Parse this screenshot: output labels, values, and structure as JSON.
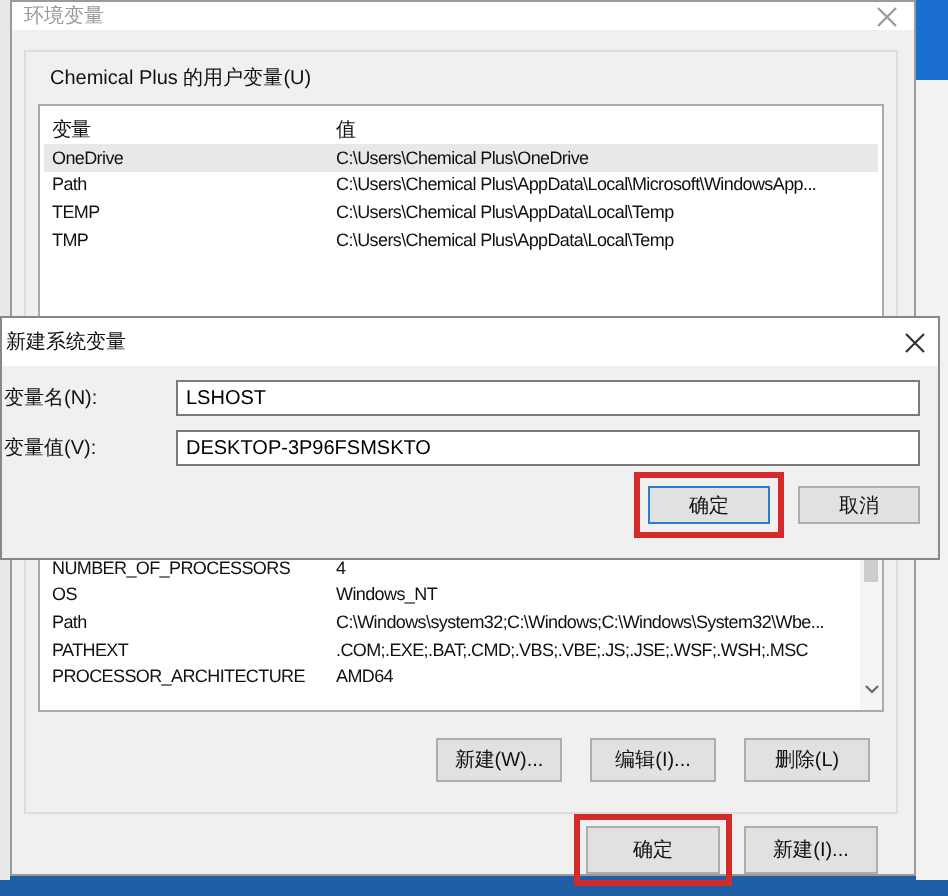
{
  "window": {
    "title": "环境变量"
  },
  "user_variables": {
    "label": "Chemical Plus 的用户变量(U)",
    "columns": [
      "变量",
      "值"
    ],
    "rows": [
      {
        "name": "OneDrive",
        "value": "C:\\Users\\Chemical Plus\\OneDrive",
        "selected": true
      },
      {
        "name": "Path",
        "value": "C:\\Users\\Chemical Plus\\AppData\\Local\\Microsoft\\WindowsApp...",
        "selected": false
      },
      {
        "name": "TEMP",
        "value": "C:\\Users\\Chemical Plus\\AppData\\Local\\Temp",
        "selected": false
      },
      {
        "name": "TMP",
        "value": "C:\\Users\\Chemical Plus\\AppData\\Local\\Temp",
        "selected": false
      }
    ]
  },
  "system_variables": {
    "rows": [
      {
        "name": "NUMBER_OF_PROCESSORS",
        "value": "4",
        "selected": false
      },
      {
        "name": "OS",
        "value": "Windows_NT",
        "selected": false
      },
      {
        "name": "Path",
        "value": "C:\\Windows\\system32;C:\\Windows;C:\\Windows\\System32\\Wbe...",
        "selected": false
      },
      {
        "name": "PATHEXT",
        "value": ".COM;.EXE;.BAT;.CMD;.VBS;.VBE;.JS;.JSE;.WSF;.WSH;.MSC",
        "selected": false
      },
      {
        "name": "PROCESSOR_ARCHITECTURE",
        "value": "AMD64",
        "selected": false
      }
    ],
    "buttons": [
      {
        "label": "新建(W)...",
        "highlighted": false
      },
      {
        "label": "编辑(I)...",
        "highlighted": false
      },
      {
        "label": "删除(L)",
        "highlighted": false
      }
    ]
  },
  "buttons": [
    {
      "label": "确定",
      "highlighted": true
    },
    {
      "label": "新建(I)...",
      "highlighted": false
    }
  ],
  "dialog": {
    "title": "新建系统变量",
    "fields": [
      {
        "label": "变量名(N):",
        "value": "LSHOST"
      },
      {
        "label": "变量值(V):",
        "value": "DESKTOP-3P96FSMSKTO"
      }
    ],
    "buttons": [
      {
        "label": "确定",
        "highlighted": true
      },
      {
        "label": "取消",
        "highlighted": false
      }
    ]
  }
}
